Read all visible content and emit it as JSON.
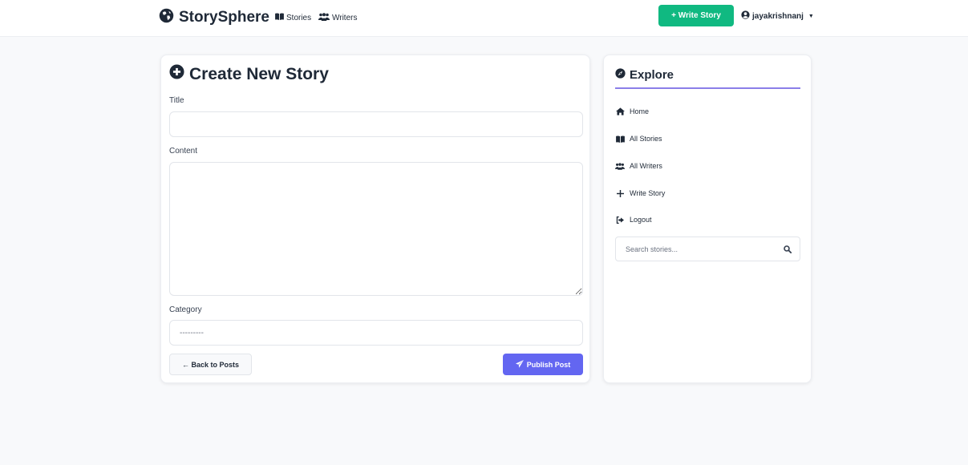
{
  "navbar": {
    "brand": "StorySphere",
    "links": [
      {
        "label": "Stories",
        "icon": "book-open-icon"
      },
      {
        "label": "Writers",
        "icon": "users-icon"
      }
    ],
    "write_button": "+ Write Story",
    "username": "jayakrishnanj"
  },
  "form": {
    "title": "Create New Story",
    "title_label": "Title",
    "title_value": "",
    "content_label": "Content",
    "content_value": "",
    "category_label": "Category",
    "category_selected": "---------",
    "back_button": "← Back to Posts",
    "publish_button": "Publish Post"
  },
  "sidebar": {
    "title": "Explore",
    "items": [
      {
        "label": "Home",
        "icon": "home-icon"
      },
      {
        "label": "All Stories",
        "icon": "book-open-icon"
      },
      {
        "label": "All Writers",
        "icon": "users-icon"
      },
      {
        "label": "Write Story",
        "icon": "plus-icon"
      },
      {
        "label": "Logout",
        "icon": "logout-icon"
      }
    ],
    "search_placeholder": "Search stories..."
  },
  "colors": {
    "accent": "#6366f1",
    "write_button": "#10b981",
    "divider": "#8b7fe8",
    "background": "#f8f9fb"
  }
}
